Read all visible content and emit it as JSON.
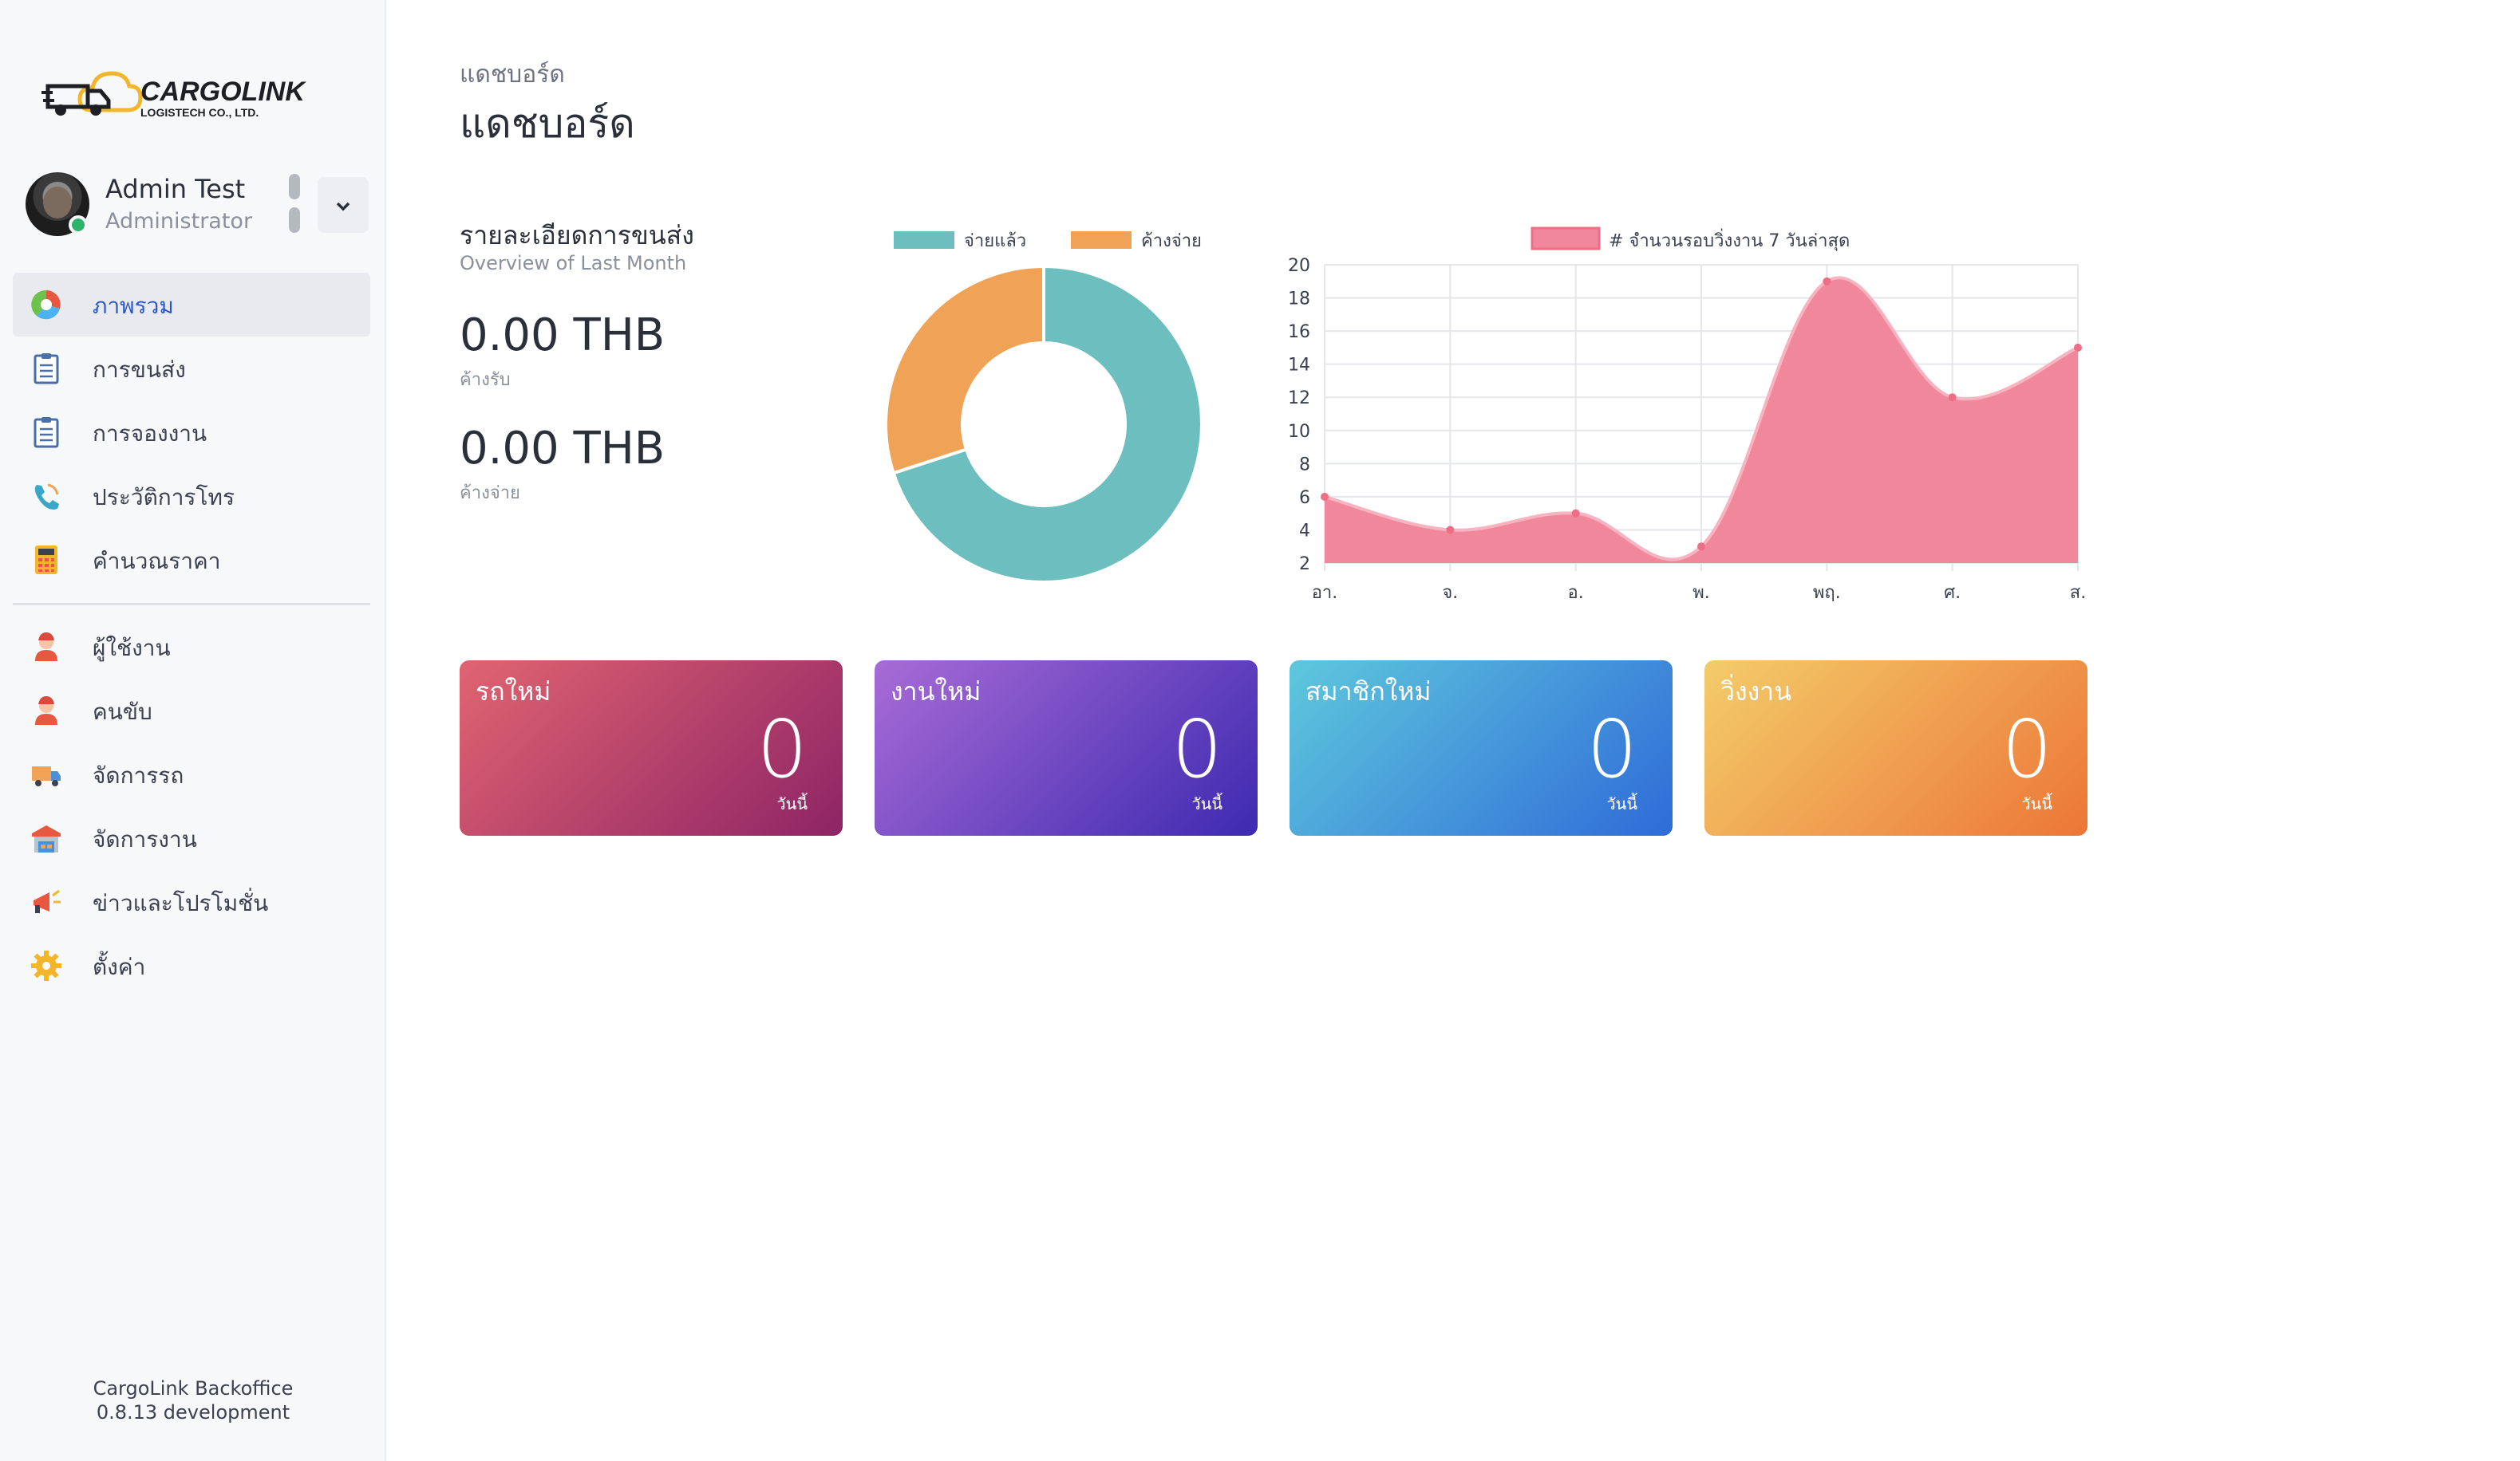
{
  "brand": {
    "name": "CARGOLINK",
    "sub": "LOGISTECH CO., LTD."
  },
  "user": {
    "name": "Admin Test",
    "role": "Administrator"
  },
  "nav": [
    {
      "label": "ภาพรวม",
      "icon": "pie-chart-icon",
      "active": true
    },
    {
      "label": "การขนส่ง",
      "icon": "clipboard-icon"
    },
    {
      "label": "การจองงาน",
      "icon": "clipboard-icon"
    },
    {
      "label": "ประวัติการโทร",
      "icon": "phone-icon"
    },
    {
      "label": "คำนวณราคา",
      "icon": "calculator-icon"
    }
  ],
  "nav2": [
    {
      "label": "ผู้ใช้งาน",
      "icon": "user-icon"
    },
    {
      "label": "คนขับ",
      "icon": "driver-icon"
    },
    {
      "label": "จัดการรถ",
      "icon": "truck-icon"
    },
    {
      "label": "จัดการงาน",
      "icon": "warehouse-icon"
    },
    {
      "label": "ข่าวและโปรโมชั่น",
      "icon": "megaphone-icon"
    },
    {
      "label": "ตั้งค่า",
      "icon": "gear-icon"
    }
  ],
  "footer": {
    "line1": "CargoLink Backoffice",
    "line2": "0.8.13 development"
  },
  "page": {
    "breadcrumb": "แดชบอร์ด",
    "title": "แดชบอร์ด"
  },
  "summary": {
    "title": "รายละเอียดการขนส่ง",
    "subtitle": "Overview of Last Month",
    "receivable": {
      "value": "0.00 THB",
      "label": "ค้างรับ"
    },
    "payable": {
      "value": "0.00 THB",
      "label": "ค้างจ่าย"
    }
  },
  "chart_data": [
    {
      "type": "pie",
      "labels": [
        "จ่ายแล้ว",
        "ค้างจ่าย"
      ],
      "values": [
        70,
        30
      ],
      "colors": [
        "#6dbfbf",
        "#f0a357"
      ],
      "legend": "top"
    },
    {
      "type": "area",
      "categories": [
        "อา.",
        "จ.",
        "อ.",
        "พ.",
        "พฤ.",
        "ศ.",
        "ส."
      ],
      "series": [
        {
          "name": "# จำนวนรอบวิ่งงาน 7 วันล่าสุด",
          "values": [
            6,
            4,
            5,
            3,
            19,
            12,
            15
          ],
          "color": "#f0879a"
        }
      ],
      "ylim": [
        2,
        20
      ],
      "yticks": [
        2,
        4,
        6,
        8,
        10,
        12,
        14,
        16,
        18,
        20
      ],
      "grid": true,
      "legend": "top"
    }
  ],
  "cards": [
    {
      "title": "รถใหม่",
      "value": "0",
      "label": "วันนี้",
      "colors": [
        "#e06470",
        "#8e2466"
      ]
    },
    {
      "title": "งานใหม่",
      "value": "0",
      "label": "วันนี้",
      "colors": [
        "#a86bd6",
        "#3d2ab0"
      ]
    },
    {
      "title": "สมาชิกใหม่",
      "value": "0",
      "label": "วันนี้",
      "colors": [
        "#5ec8dc",
        "#2f6bd8"
      ]
    },
    {
      "title": "วิ่งงาน",
      "value": "0",
      "label": "วันนี้",
      "colors": [
        "#f3cc6a",
        "#ec7637"
      ]
    }
  ]
}
